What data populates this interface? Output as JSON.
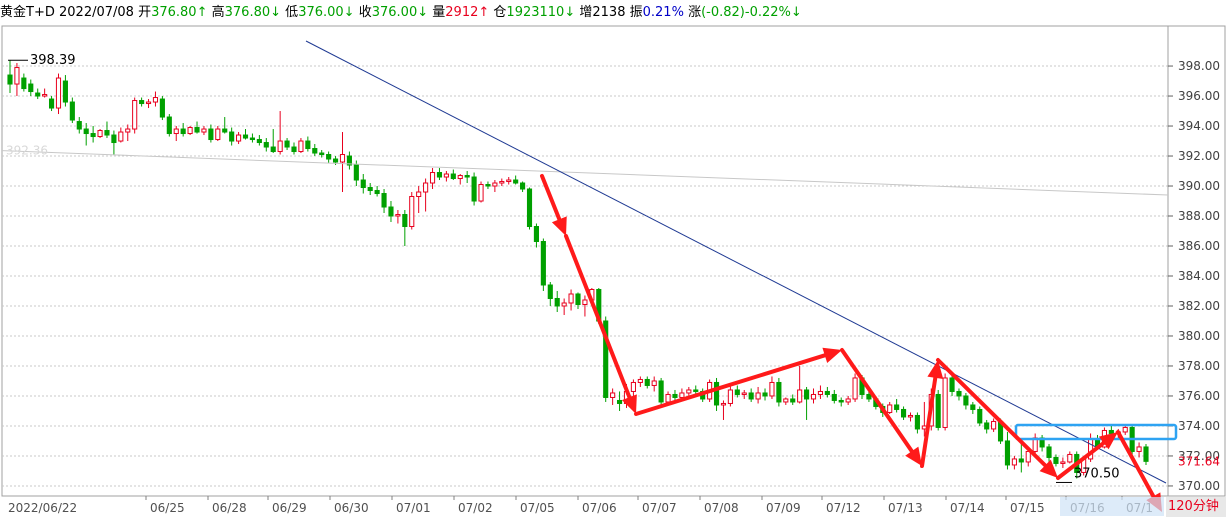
{
  "info_bar": {
    "symbol": "黄金T+D",
    "date": "2022/07/08",
    "open_label": "开",
    "open_value": "376.80↑",
    "high_label": "高",
    "high_value": "376.80↓",
    "low_label": "低",
    "low_value": "376.00↓",
    "close_label": "收",
    "close_value": "376.00↓",
    "volume_label": "量",
    "volume_value": "2912↑",
    "oi_label": "仓",
    "oi_value": "1923110↓",
    "inc_label": "增",
    "inc_value": "2138",
    "amp_label": "振",
    "amp_value": "0.21%",
    "chg_label": "涨",
    "chg_value": "(-0.82)-0.22%↓"
  },
  "period_label": "120分钟",
  "colors": {
    "up": "#e8001e",
    "down": "#00a000",
    "trendline": "#1f3a93",
    "arrows": "#ff1a1a",
    "box": "#2ea3f2",
    "grid": "#c8c8c8"
  },
  "chart_data": {
    "type": "candlestick",
    "title": "黄金T+D",
    "ylim": [
      370.0,
      400.0
    ],
    "y_ticks": [
      "398.00",
      "396.00",
      "394.00",
      "392.00",
      "390.00",
      "388.00",
      "386.00",
      "384.00",
      "382.00",
      "380.00",
      "378.00",
      "376.00",
      "374.00",
      "372.00",
      "370.00"
    ],
    "y_tick_values": [
      398,
      396,
      394,
      392,
      390,
      388,
      386,
      384,
      382,
      380,
      378,
      376,
      374,
      372,
      370
    ],
    "x_tick_labels": [
      "2022/06/22",
      "06/25",
      "06/28",
      "06/29",
      "06/30",
      "07/01",
      "07/02",
      "07/05",
      "07/06",
      "07/07",
      "07/08",
      "07/09",
      "07/12",
      "07/13",
      "07/14",
      "07/15",
      "07/16",
      "07/1"
    ],
    "annotations": {
      "max_label": "398.39",
      "max_value": 398.39,
      "min_label": "370.50",
      "min_value": 370.5,
      "last_price_label": "371.64",
      "last_price_value": 371.64,
      "faded_level_label": "392.36",
      "faded_level_value": 392.36
    },
    "candles": [
      [
        397.4,
        398.4,
        396.2,
        396.8
      ],
      [
        396.8,
        398.2,
        396.0,
        397.9
      ],
      [
        397.2,
        397.5,
        396.3,
        396.5
      ],
      [
        396.8,
        397.1,
        396.0,
        396.3
      ],
      [
        396.2,
        396.5,
        395.8,
        396.0
      ],
      [
        396.0,
        396.5,
        395.9,
        396.1
      ],
      [
        395.8,
        396.0,
        395.0,
        395.2
      ],
      [
        395.2,
        397.5,
        394.8,
        397.2
      ],
      [
        397.0,
        397.4,
        395.3,
        395.6
      ],
      [
        395.6,
        395.9,
        394.2,
        394.4
      ],
      [
        394.3,
        394.6,
        393.5,
        393.8
      ],
      [
        393.8,
        394.2,
        392.7,
        393.5
      ],
      [
        393.5,
        394.0,
        392.9,
        393.3
      ],
      [
        393.3,
        393.8,
        393.2,
        393.7
      ],
      [
        393.7,
        394.3,
        393.2,
        393.4
      ],
      [
        393.4,
        393.7,
        392.1,
        392.9
      ],
      [
        393.0,
        393.9,
        392.9,
        393.6
      ],
      [
        393.6,
        394.1,
        393.0,
        393.8
      ],
      [
        393.8,
        395.9,
        393.5,
        395.7
      ],
      [
        395.7,
        395.9,
        395.3,
        395.5
      ],
      [
        395.5,
        395.8,
        395.2,
        395.6
      ],
      [
        395.6,
        396.3,
        395.3,
        395.9
      ],
      [
        395.8,
        396.0,
        394.4,
        394.6
      ],
      [
        394.6,
        394.8,
        393.3,
        393.5
      ],
      [
        393.5,
        394.0,
        393.0,
        393.8
      ],
      [
        393.8,
        394.2,
        393.3,
        393.5
      ],
      [
        393.5,
        394.0,
        393.4,
        393.9
      ],
      [
        393.9,
        394.3,
        393.5,
        393.6
      ],
      [
        393.6,
        394.0,
        393.4,
        393.8
      ],
      [
        393.8,
        394.1,
        392.9,
        393.1
      ],
      [
        393.1,
        394.0,
        393.0,
        393.8
      ],
      [
        393.8,
        394.6,
        393.5,
        393.6
      ],
      [
        393.6,
        393.9,
        392.7,
        393.0
      ],
      [
        393.0,
        393.6,
        392.8,
        393.4
      ],
      [
        393.4,
        393.8,
        393.1,
        393.2
      ],
      [
        393.2,
        393.5,
        392.9,
        393.1
      ],
      [
        393.1,
        393.4,
        392.7,
        392.9
      ],
      [
        392.9,
        393.2,
        392.3,
        392.6
      ],
      [
        392.6,
        393.8,
        392.2,
        392.3
      ],
      [
        392.3,
        395.0,
        392.1,
        393.0
      ],
      [
        393.0,
        393.2,
        392.4,
        392.6
      ],
      [
        392.6,
        392.9,
        392.1,
        392.3
      ],
      [
        392.3,
        393.2,
        392.2,
        393.0
      ],
      [
        393.0,
        393.3,
        392.3,
        392.5
      ],
      [
        392.5,
        392.8,
        392.0,
        392.2
      ],
      [
        392.2,
        392.4,
        391.9,
        392.1
      ],
      [
        392.1,
        392.3,
        391.5,
        391.8
      ],
      [
        391.8,
        392.0,
        391.4,
        391.6
      ],
      [
        391.6,
        393.6,
        389.6,
        392.1
      ],
      [
        392.0,
        392.3,
        391.1,
        391.4
      ],
      [
        391.4,
        391.7,
        390.0,
        390.4
      ],
      [
        390.4,
        390.8,
        389.5,
        389.9
      ],
      [
        389.9,
        390.2,
        389.4,
        389.7
      ],
      [
        389.7,
        390.0,
        389.3,
        389.5
      ],
      [
        389.5,
        389.8,
        388.2,
        388.6
      ],
      [
        388.6,
        389.0,
        387.6,
        388.0
      ],
      [
        388.0,
        388.4,
        387.5,
        388.1
      ],
      [
        388.1,
        388.4,
        386.0,
        387.3
      ],
      [
        387.3,
        389.6,
        387.1,
        389.3
      ],
      [
        389.3,
        390.0,
        388.2,
        389.6
      ],
      [
        389.6,
        390.5,
        388.3,
        390.2
      ],
      [
        390.2,
        391.2,
        389.8,
        390.9
      ],
      [
        390.9,
        391.2,
        390.4,
        390.6
      ],
      [
        390.6,
        391.0,
        390.3,
        390.8
      ],
      [
        390.8,
        391.1,
        390.4,
        390.5
      ],
      [
        390.5,
        390.8,
        390.1,
        390.7
      ],
      [
        390.7,
        391.0,
        390.2,
        390.6
      ],
      [
        390.6,
        390.9,
        388.7,
        389.0
      ],
      [
        389.0,
        390.3,
        388.9,
        390.1
      ],
      [
        390.1,
        390.3,
        389.8,
        390.0
      ],
      [
        390.0,
        390.4,
        389.6,
        390.2
      ],
      [
        390.2,
        390.5,
        390.0,
        390.3
      ],
      [
        390.3,
        390.6,
        390.1,
        390.4
      ],
      [
        390.4,
        390.7,
        390.1,
        390.2
      ],
      [
        390.2,
        390.3,
        389.6,
        389.8
      ],
      [
        389.8,
        389.9,
        387.1,
        387.3
      ],
      [
        387.3,
        387.5,
        385.9,
        386.3
      ],
      [
        386.3,
        386.5,
        383.0,
        383.4
      ],
      [
        383.4,
        383.6,
        382.0,
        382.5
      ],
      [
        382.5,
        383.0,
        381.6,
        382.0
      ],
      [
        382.0,
        382.5,
        381.4,
        382.2
      ],
      [
        382.2,
        383.1,
        381.7,
        382.8
      ],
      [
        382.8,
        382.9,
        381.8,
        382.1
      ],
      [
        382.1,
        382.7,
        381.3,
        382.4
      ],
      [
        382.4,
        383.2,
        382.2,
        383.1
      ],
      [
        383.1,
        383.2,
        380.8,
        381.0
      ],
      [
        381.0,
        381.3,
        375.6,
        375.9
      ],
      [
        375.9,
        376.5,
        375.4,
        376.2
      ],
      [
        375.7,
        376.3,
        375.0,
        375.5
      ],
      [
        375.5,
        376.8,
        375.2,
        376.3
      ],
      [
        376.3,
        377.1,
        376.0,
        376.9
      ],
      [
        376.9,
        377.3,
        376.6,
        377.1
      ],
      [
        377.1,
        377.3,
        376.5,
        376.7
      ],
      [
        376.7,
        377.3,
        376.3,
        377.0
      ],
      [
        377.0,
        377.2,
        375.3,
        375.6
      ],
      [
        375.6,
        376.3,
        375.4,
        376.1
      ],
      [
        376.1,
        376.4,
        375.6,
        375.9
      ],
      [
        375.9,
        376.5,
        375.7,
        376.2
      ],
      [
        376.2,
        376.6,
        375.9,
        376.4
      ],
      [
        376.4,
        376.7,
        376.1,
        376.3
      ],
      [
        376.3,
        376.5,
        375.6,
        375.8
      ],
      [
        375.8,
        377.1,
        375.6,
        376.9
      ],
      [
        376.9,
        377.2,
        375.0,
        375.4
      ],
      [
        375.4,
        375.7,
        374.4,
        375.5
      ],
      [
        375.5,
        376.7,
        375.3,
        376.4
      ],
      [
        376.4,
        376.7,
        375.9,
        376.1
      ],
      [
        376.1,
        376.4,
        375.8,
        376.2
      ],
      [
        376.2,
        376.5,
        375.6,
        375.8
      ],
      [
        375.8,
        376.6,
        375.5,
        376.2
      ],
      [
        376.2,
        376.5,
        375.7,
        376.0
      ],
      [
        376.0,
        377.3,
        375.8,
        376.9
      ],
      [
        376.9,
        377.2,
        375.3,
        375.6
      ],
      [
        375.6,
        375.9,
        375.4,
        375.8
      ],
      [
        375.8,
        376.1,
        375.4,
        375.6
      ],
      [
        375.6,
        378.0,
        375.5,
        376.4
      ],
      [
        376.4,
        376.6,
        374.4,
        375.8
      ],
      [
        375.8,
        376.5,
        375.5,
        376.1
      ],
      [
        376.1,
        376.7,
        375.8,
        376.3
      ],
      [
        376.3,
        376.6,
        375.9,
        376.1
      ],
      [
        376.1,
        376.4,
        375.5,
        375.7
      ],
      [
        375.7,
        375.9,
        375.3,
        375.6
      ],
      [
        375.6,
        376.0,
        375.4,
        375.8
      ],
      [
        375.8,
        377.5,
        375.6,
        377.2
      ],
      [
        377.2,
        377.4,
        375.8,
        376.1
      ],
      [
        376.1,
        376.3,
        375.6,
        375.8
      ],
      [
        375.8,
        376.0,
        375.1,
        375.3
      ],
      [
        375.3,
        375.5,
        374.6,
        374.9
      ],
      [
        374.9,
        375.6,
        374.8,
        375.4
      ],
      [
        375.4,
        375.8,
        374.9,
        375.1
      ],
      [
        375.1,
        375.3,
        374.4,
        374.6
      ],
      [
        374.6,
        374.9,
        374.3,
        374.7
      ],
      [
        374.7,
        374.9,
        373.5,
        373.8
      ],
      [
        373.8,
        375.6,
        373.3,
        374.0
      ],
      [
        374.0,
        376.5,
        373.7,
        376.1
      ],
      [
        376.1,
        376.4,
        373.7,
        373.9
      ],
      [
        373.9,
        377.5,
        373.7,
        377.2
      ],
      [
        377.2,
        377.4,
        376.0,
        376.3
      ],
      [
        376.3,
        376.5,
        375.7,
        376.0
      ],
      [
        376.0,
        376.2,
        375.1,
        375.4
      ],
      [
        375.4,
        375.6,
        374.8,
        375.1
      ],
      [
        375.1,
        375.3,
        374.0,
        374.2
      ],
      [
        374.2,
        374.4,
        373.5,
        373.8
      ],
      [
        373.8,
        374.5,
        373.6,
        374.3
      ],
      [
        374.3,
        374.5,
        372.8,
        373.0
      ],
      [
        373.0,
        373.6,
        371.1,
        371.4
      ],
      [
        371.4,
        372.0,
        371.1,
        371.8
      ],
      [
        371.8,
        372.8,
        370.9,
        371.6
      ],
      [
        371.6,
        372.5,
        371.3,
        372.3
      ],
      [
        372.3,
        373.5,
        372.1,
        373.2
      ],
      [
        373.2,
        373.4,
        372.3,
        372.6
      ],
      [
        372.6,
        372.8,
        371.6,
        371.9
      ],
      [
        371.9,
        372.1,
        371.3,
        371.5
      ],
      [
        371.5,
        371.9,
        371.2,
        371.6
      ],
      [
        371.6,
        372.3,
        371.5,
        372.1
      ],
      [
        372.1,
        372.3,
        370.5,
        370.9
      ],
      [
        370.9,
        372.0,
        370.7,
        371.8
      ],
      [
        371.8,
        373.5,
        371.6,
        373.1
      ],
      [
        373.1,
        373.4,
        372.4,
        372.6
      ],
      [
        372.6,
        373.9,
        372.5,
        373.7
      ],
      [
        373.7,
        374.0,
        373.3,
        373.5
      ],
      [
        373.5,
        373.8,
        373.2,
        373.6
      ],
      [
        373.6,
        374.1,
        373.4,
        373.9
      ],
      [
        373.9,
        374.0,
        372.1,
        372.3
      ],
      [
        372.3,
        372.9,
        371.9,
        372.6
      ],
      [
        372.6,
        372.8,
        371.4,
        371.64
      ]
    ]
  }
}
